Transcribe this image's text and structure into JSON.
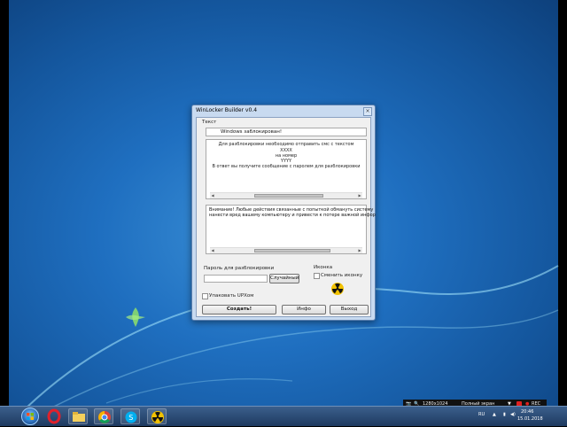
{
  "window": {
    "title": "WinLocker Builder v0.4",
    "close_glyph": "×",
    "text_section_label": "Текст",
    "header_value": "Windows заблокирован!",
    "message_lines": [
      "Для разблокировки необходимо отправить смс с текстом",
      "XXXX",
      "на номер",
      "YYYY",
      "В ответ вы получите сообщение с паролем для разблокировки"
    ],
    "warning_lines": [
      "Внимание! Любые действия связанные с попыткой обмануть систему",
      "нанести вред вашему компьютеру и привести к потере важной инфор"
    ],
    "password_label": "Пароль для разблокировки",
    "password_value": "",
    "random_button": "Случайный",
    "icon_section_label": "Иконка",
    "change_icon_label": "Сменить иконку",
    "upx_label": "Упаковать UPXом",
    "create_button": "Создать!",
    "info_button": "Инфо",
    "exit_button": "Выход"
  },
  "recorder": {
    "resolution": "1280x1024",
    "mode": "Полный экран",
    "rec_label": "REC"
  },
  "tray": {
    "language": "RU",
    "time": "20:46",
    "date": "15.01.2018"
  },
  "taskbar_icons": [
    "windows-start-icon",
    "opera-icon",
    "file-explorer-icon",
    "chrome-icon",
    "skype-icon",
    "radiation-icon"
  ],
  "colors": {
    "desktop": "#1f6fc0",
    "window_frame": "#c8daf0",
    "taskbar": "#1e3a60",
    "rec_red": "#e02020"
  }
}
